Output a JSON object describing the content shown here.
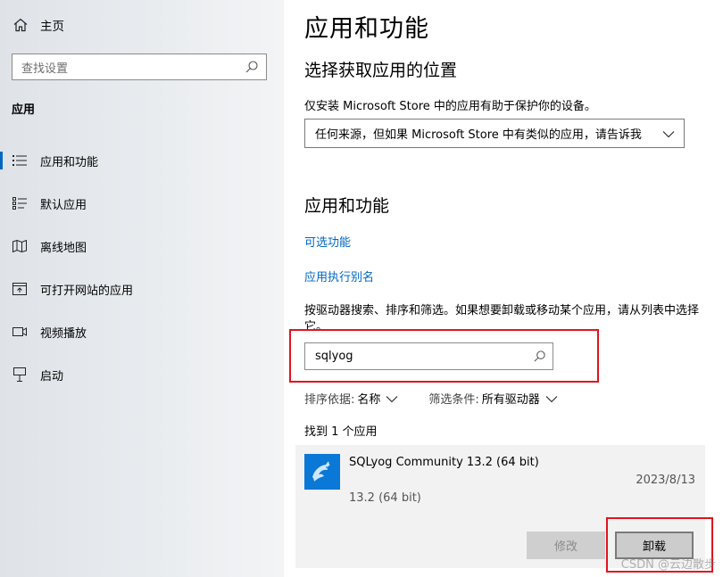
{
  "sidebar": {
    "home_label": "主页",
    "search_placeholder": "查找设置",
    "section_title": "应用",
    "items": [
      {
        "label": "应用和功能",
        "icon": "apps-list-icon",
        "active": true
      },
      {
        "label": "默认应用",
        "icon": "default-apps-icon",
        "active": false
      },
      {
        "label": "离线地图",
        "icon": "map-icon",
        "active": false
      },
      {
        "label": "可打开网站的应用",
        "icon": "website-apps-icon",
        "active": false
      },
      {
        "label": "视频播放",
        "icon": "video-icon",
        "active": false
      },
      {
        "label": "启动",
        "icon": "startup-icon",
        "active": false
      }
    ]
  },
  "main": {
    "title": "应用和功能",
    "install_source": {
      "heading": "选择获取应用的位置",
      "desc": "仅安装 Microsoft Store 中的应用有助于保护你的设备。",
      "dropdown_value": "任何来源，但如果 Microsoft Store 中有类似的应用，请告诉我"
    },
    "apps_section": {
      "heading": "应用和功能",
      "link_optional": "可选功能",
      "link_alias": "应用执行别名",
      "desc": "按驱动器搜索、排序和筛选。如果想要卸载或移动某个应用，请从列表中选择它。",
      "search_value": "sqlyog",
      "sort_key": "排序依据:",
      "sort_value": "名称",
      "filter_key": "筛选条件:",
      "filter_value": "所有驱动器",
      "found_text": "找到 1 个应用"
    },
    "app": {
      "name": "SQLyog Community 13.2 (64 bit)",
      "date": "2023/8/13",
      "version": "13.2 (64 bit)",
      "modify_label": "修改",
      "uninstall_label": "卸载"
    },
    "watermark": "CSDN @云边散步"
  },
  "colors": {
    "accent": "#0067c0",
    "highlight": "#e0141e",
    "app_icon_bg": "#0a78d7"
  }
}
